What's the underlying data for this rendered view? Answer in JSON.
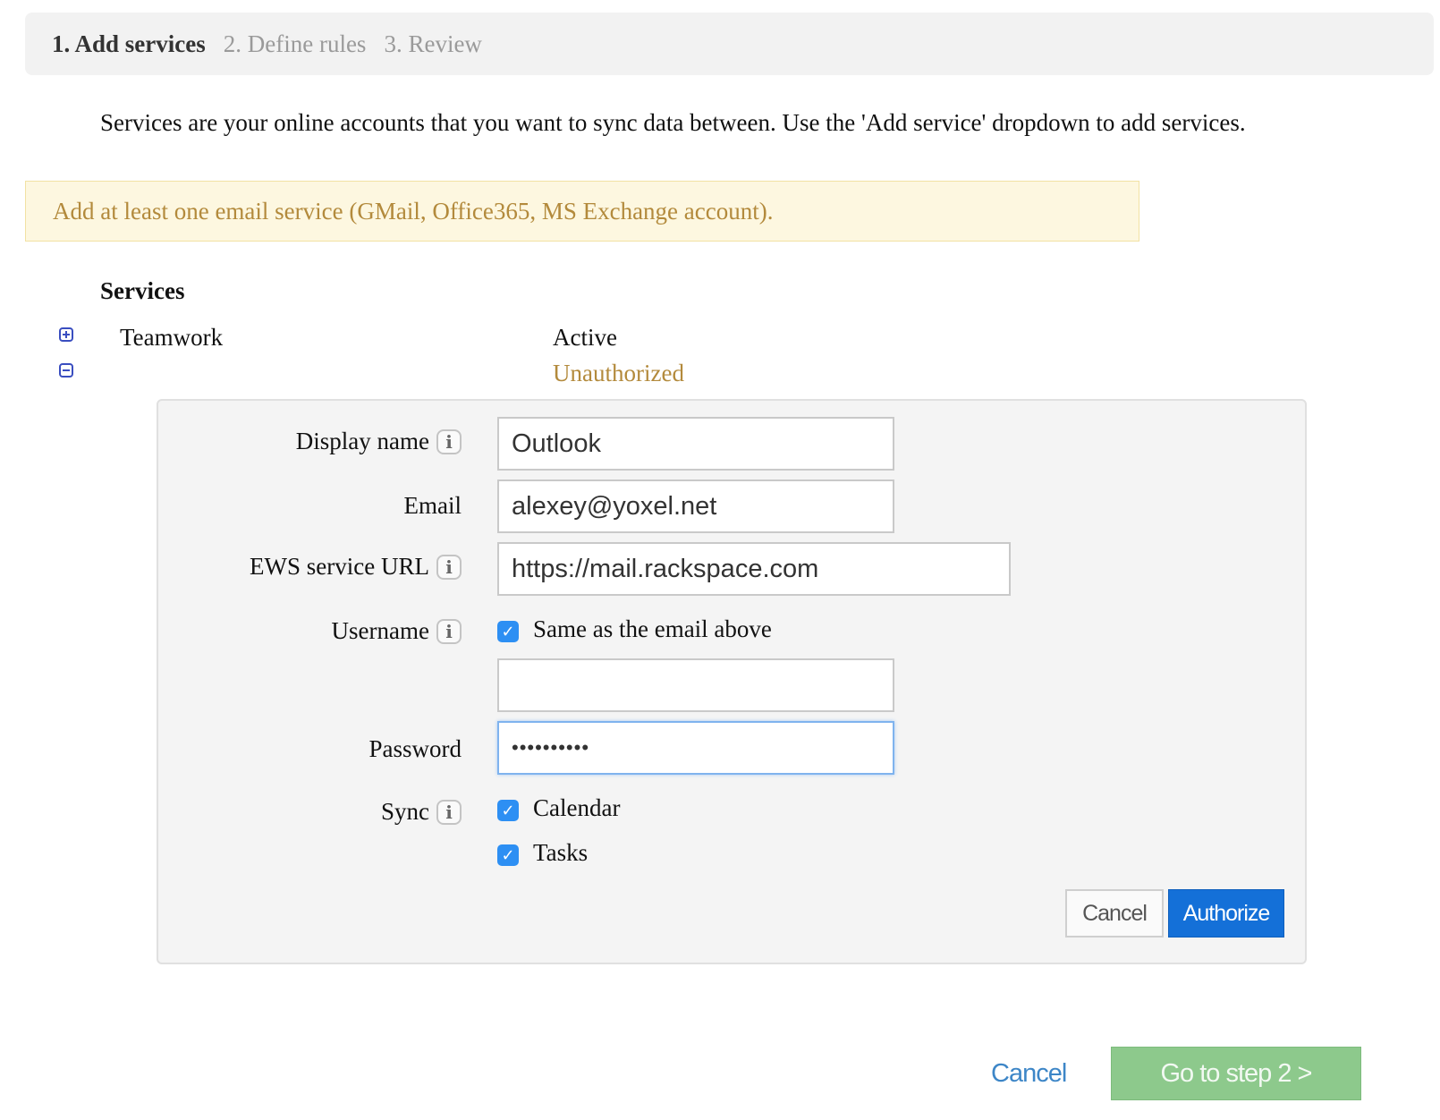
{
  "steps": [
    {
      "label": "1. Add services",
      "active": true
    },
    {
      "label": "2. Define rules",
      "active": false
    },
    {
      "label": "3. Review",
      "active": false
    }
  ],
  "intro": "Services are your online accounts that you want to sync data between. Use the 'Add service' dropdown to add services.",
  "warning": "Add at least one email service (GMail, Office365, MS Exchange account).",
  "services_heading": "Services",
  "services": [
    {
      "name": "Teamwork",
      "status": "Active",
      "expanded": false
    },
    {
      "name": "",
      "status": "Unauthorized",
      "expanded": true
    }
  ],
  "form": {
    "display_name": {
      "label": "Display name",
      "value": "Outlook"
    },
    "email": {
      "label": "Email",
      "value": "alexey@yoxel.net"
    },
    "ews_url": {
      "label": "EWS service URL",
      "value": "https://mail.rackspace.com"
    },
    "username": {
      "label": "Username",
      "same_as_email_label": "Same as the email above",
      "same_as_email_checked": true,
      "value": ""
    },
    "password": {
      "label": "Password",
      "value": "••••••••••"
    },
    "sync": {
      "label": "Sync",
      "options": [
        {
          "label": "Calendar",
          "checked": true
        },
        {
          "label": "Tasks",
          "checked": true
        }
      ]
    },
    "cancel_label": "Cancel",
    "authorize_label": "Authorize"
  },
  "footer": {
    "cancel_label": "Cancel",
    "next_label": "Go to step 2 >"
  },
  "colors": {
    "warning_text": "#b38a3c",
    "authorize_bg": "#1470d8",
    "next_bg": "#8dc98c",
    "checkbox": "#2d8ff3"
  }
}
